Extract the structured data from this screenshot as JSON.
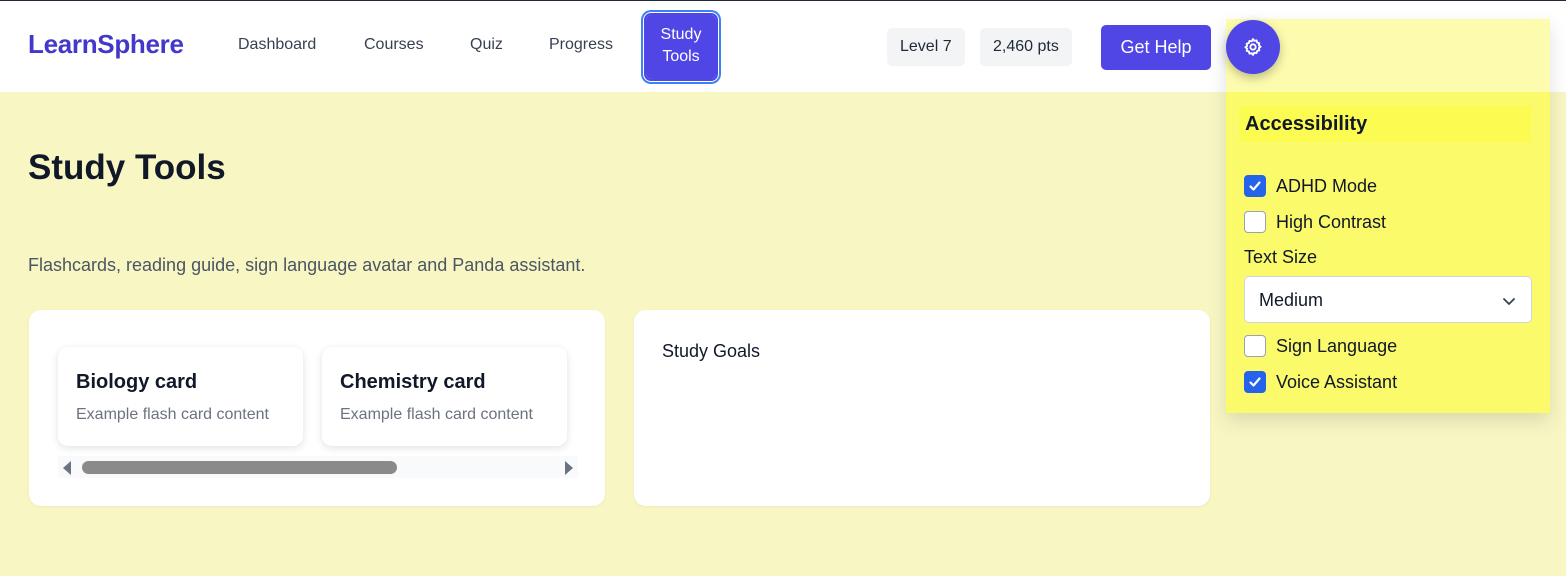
{
  "header": {
    "brand": "LearnSphere",
    "nav": [
      "Dashboard",
      "Courses",
      "Quiz",
      "Progress"
    ],
    "active_nav_line1": "Study",
    "active_nav_line2": "Tools",
    "level": "Level 7",
    "points": "2,460 pts",
    "help_label": "Get Help",
    "settings_icon": "gear-icon"
  },
  "accessibility": {
    "title": "Accessibility",
    "options": [
      {
        "label": "ADHD Mode",
        "checked": true
      },
      {
        "label": "High Contrast",
        "checked": false
      },
      {
        "label": "Sign Language",
        "checked": false
      },
      {
        "label": "Voice Assistant",
        "checked": true
      }
    ],
    "text_size_label": "Text Size",
    "text_size_value": "Medium"
  },
  "main": {
    "title": "Study Tools",
    "description": "Flashcards, reading guide, sign language avatar and Panda assistant.",
    "flashcards": [
      {
        "title": "Biology card",
        "body": "Example flash card content"
      },
      {
        "title": "Chemistry card",
        "body": "Example flash card content"
      }
    ],
    "goals_title": "Study Goals"
  },
  "colors": {
    "accent": "#4f46e5",
    "brand": "#4338ca",
    "page_background": "#f8f7c4",
    "panel_highlight": "#fbfa6b",
    "checkbox_checked": "#2563eb"
  }
}
